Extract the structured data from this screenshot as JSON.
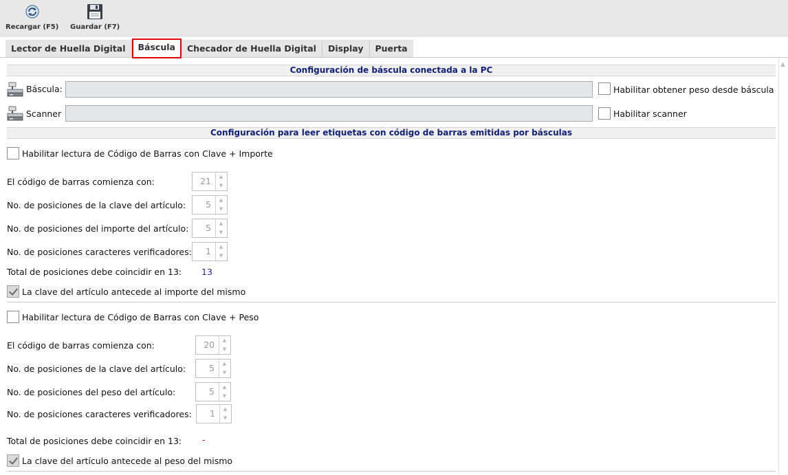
{
  "toolbar": {
    "reload_label": "Recargar (F5)",
    "save_label": "Guardar (F7)"
  },
  "tabs": [
    {
      "label": "Lector de Huella Digital",
      "active": false
    },
    {
      "label": "Báscula",
      "active": true
    },
    {
      "label": "Checador de Huella Digital",
      "active": false
    },
    {
      "label": "Display",
      "active": false
    },
    {
      "label": "Puerta",
      "active": false
    }
  ],
  "pc_config": {
    "header": "Configuración de báscula conectada a la PC",
    "scale_label": "Báscula:",
    "scale_value": "",
    "scale_enable_label": "Habilitar obtener peso desde báscula",
    "scale_enable_checked": false,
    "scanner_label": "Scanner",
    "scanner_value": "",
    "scanner_enable_label": "Habilitar scanner",
    "scanner_enable_checked": false
  },
  "barcode_config": {
    "header": "Configuración para leer etiquetas con código de barras emitidas por básculas",
    "amount": {
      "enable_label": "Habilitar lectura de Código de Barras con Clave + Importe",
      "enable_checked": false,
      "starts_with_label": "El código de barras comienza con:",
      "starts_with_value": "21",
      "key_positions_label": "No. de posiciones de la clave del artículo:",
      "key_positions_value": "5",
      "amount_positions_label": "No. de posiciones del importe del artículo:",
      "amount_positions_value": "5",
      "check_positions_label": "No. de posiciones caracteres verificadores:",
      "check_positions_value": "1",
      "total_label": "Total de posiciones debe coincidir en 13:",
      "total_value": "13",
      "key_first_label": "La clave del artículo antecede al importe del mismo",
      "key_first_checked": true
    },
    "weight": {
      "enable_label": "Habilitar lectura de Código de Barras con Clave + Peso",
      "enable_checked": false,
      "starts_with_label": "El código de barras comienza con:",
      "starts_with_value": "20",
      "key_positions_label": "No. de posiciones de la clave del artículo:",
      "key_positions_value": "5",
      "weight_positions_label": "No. de posiciones del peso del artículo:",
      "weight_positions_value": "5",
      "check_positions_label": "No. de posiciones caracteres verificadores:",
      "check_positions_value": "1",
      "total_label": "Total de posiciones debe coincidir en 13:",
      "total_value": "-",
      "key_first_label": "La clave del artículo antecede al peso del mismo",
      "key_first_checked": true
    }
  },
  "colors": {
    "header_text": "#0f1f7a",
    "total_value": "#1a2d8c",
    "active_tab_border": "#e00000"
  },
  "icons": {
    "reload": "reload-icon",
    "save": "floppy-disk-icon",
    "scale": "scale-device-icon",
    "scanner": "scanner-device-icon"
  }
}
